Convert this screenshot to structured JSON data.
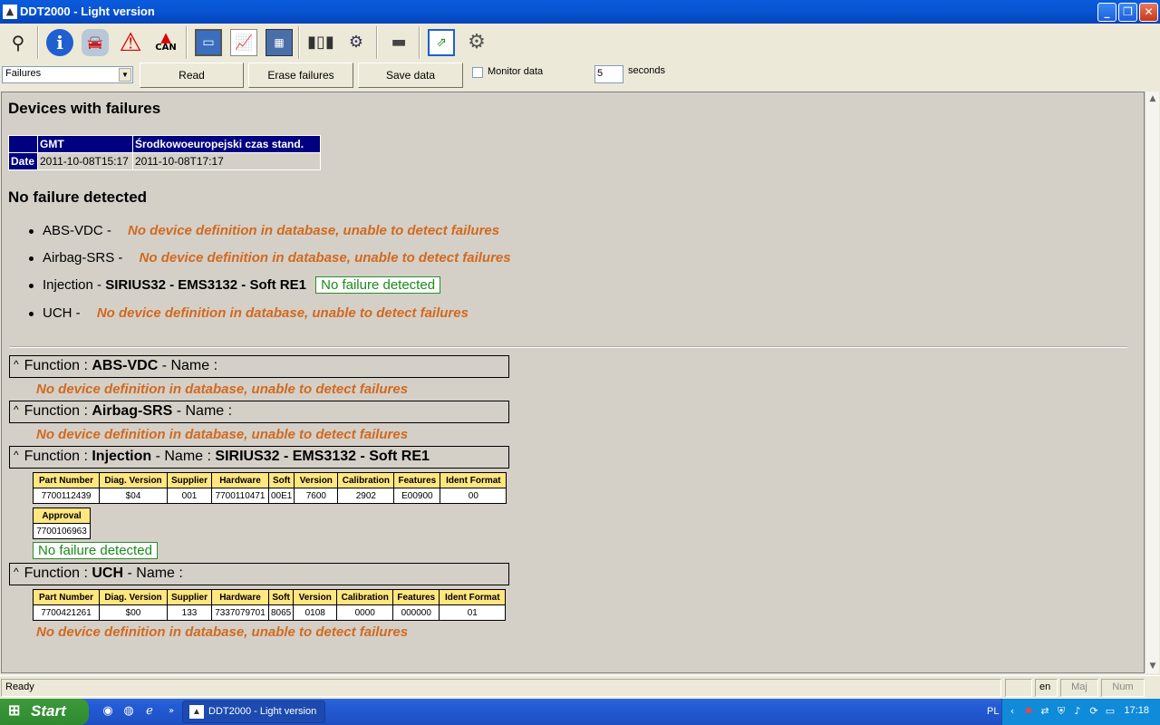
{
  "window": {
    "title": "DDT2000 - Light version",
    "app_icon": "ddt-app-icon"
  },
  "toolbar": {
    "icons": [
      "binoculars-icon",
      "info-icon",
      "car-sensor-icon",
      "warning-icon",
      "can-warning-icon",
      "monitor-icon",
      "chart-save-icon",
      "dashboard-icon",
      "barcode-scanner-icon",
      "injector-icon",
      "chip-icon",
      "window-switch-icon",
      "gears-icon"
    ],
    "can_label": "CAN"
  },
  "controls": {
    "mode_select": "Failures",
    "read_label": "Read",
    "erase_label": "Erase failures",
    "save_label": "Save data",
    "monitor_label": "Monitor data",
    "interval_value": "5",
    "seconds_label": "seconds"
  },
  "report": {
    "devices_title": "Devices with failures",
    "date_table": {
      "headers": [
        "GMT",
        "Środkowoeuropejski czas stand."
      ],
      "row_label": "Date",
      "values": [
        "2011-10-08T15:17",
        "2011-10-08T17:17"
      ]
    },
    "status_title": "No failure detected",
    "devices": [
      {
        "name": "ABS-VDC -",
        "message": "No device definition in database, unable to detect failures"
      },
      {
        "name": "Airbag-SRS -",
        "message": "No device definition in database, unable to detect failures"
      },
      {
        "name": "Injection -",
        "soft": "SIRIUS32 - EMS3132 - Soft RE1",
        "badge": "No failure detected"
      },
      {
        "name": "UCH -",
        "message": "No device definition in database, unable to detect failures"
      }
    ],
    "functions": [
      {
        "caret": "^",
        "prefix": "Function :",
        "name": "ABS-VDC",
        "sep": "- Name :",
        "soft": "",
        "message": "No device definition in database, unable to detect failures"
      },
      {
        "caret": "^",
        "prefix": "Function :",
        "name": "Airbag-SRS",
        "sep": "- Name :",
        "soft": "",
        "message": "No device definition in database, unable to detect failures"
      },
      {
        "caret": "^",
        "prefix": "Function :",
        "name": "Injection",
        "sep": "- Name :",
        "soft": "SIRIUS32 - EMS3132 - Soft RE1",
        "ident_headers": [
          "Part Number",
          "Diag. Version",
          "Supplier",
          "Hardware",
          "Soft",
          "Version",
          "Calibration",
          "Features",
          "Ident Format"
        ],
        "ident_values": [
          "7700112439",
          "$04",
          "001",
          "7700110471",
          "00E1",
          "7600",
          "2902",
          "E00900",
          "00"
        ],
        "approval_header": "Approval",
        "approval_value": "7700106963",
        "badge": "No failure detected"
      },
      {
        "caret": "^",
        "prefix": "Function :",
        "name": "UCH",
        "sep": "- Name :",
        "soft": "",
        "ident_headers": [
          "Part Number",
          "Diag. Version",
          "Supplier",
          "Hardware",
          "Soft",
          "Version",
          "Calibration",
          "Features",
          "Ident Format"
        ],
        "ident_values": [
          "7700421261",
          "$00",
          "133",
          "7337079701",
          "8065",
          "0108",
          "0000",
          "000000",
          "01"
        ],
        "message": "No device definition in database, unable to detect failures"
      }
    ]
  },
  "statusbar": {
    "status": "Ready",
    "lang": "en",
    "caps": "Maj",
    "num": "Num"
  },
  "taskbar": {
    "start_label": "Start",
    "task_label": "DDT2000 - Light version",
    "lang_indicator": "PL",
    "clock": "17:18"
  },
  "colors": {
    "orange_text": "#d2691e",
    "ok_green": "#1a8c1a",
    "header_navy": "#000080",
    "ident_header_yellow": "#ffe680"
  }
}
